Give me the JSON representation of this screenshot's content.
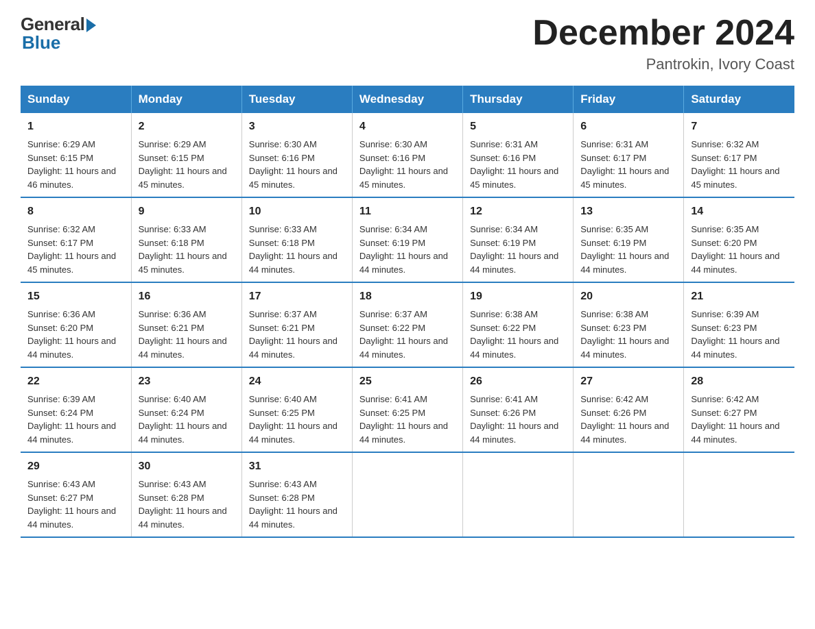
{
  "logo": {
    "general": "General",
    "blue": "Blue"
  },
  "title": "December 2024",
  "location": "Pantrokin, Ivory Coast",
  "weekdays": [
    "Sunday",
    "Monday",
    "Tuesday",
    "Wednesday",
    "Thursday",
    "Friday",
    "Saturday"
  ],
  "weeks": [
    [
      {
        "day": "1",
        "sunrise": "6:29 AM",
        "sunset": "6:15 PM",
        "daylight": "11 hours and 46 minutes."
      },
      {
        "day": "2",
        "sunrise": "6:29 AM",
        "sunset": "6:15 PM",
        "daylight": "11 hours and 45 minutes."
      },
      {
        "day": "3",
        "sunrise": "6:30 AM",
        "sunset": "6:16 PM",
        "daylight": "11 hours and 45 minutes."
      },
      {
        "day": "4",
        "sunrise": "6:30 AM",
        "sunset": "6:16 PM",
        "daylight": "11 hours and 45 minutes."
      },
      {
        "day": "5",
        "sunrise": "6:31 AM",
        "sunset": "6:16 PM",
        "daylight": "11 hours and 45 minutes."
      },
      {
        "day": "6",
        "sunrise": "6:31 AM",
        "sunset": "6:17 PM",
        "daylight": "11 hours and 45 minutes."
      },
      {
        "day": "7",
        "sunrise": "6:32 AM",
        "sunset": "6:17 PM",
        "daylight": "11 hours and 45 minutes."
      }
    ],
    [
      {
        "day": "8",
        "sunrise": "6:32 AM",
        "sunset": "6:17 PM",
        "daylight": "11 hours and 45 minutes."
      },
      {
        "day": "9",
        "sunrise": "6:33 AM",
        "sunset": "6:18 PM",
        "daylight": "11 hours and 45 minutes."
      },
      {
        "day": "10",
        "sunrise": "6:33 AM",
        "sunset": "6:18 PM",
        "daylight": "11 hours and 44 minutes."
      },
      {
        "day": "11",
        "sunrise": "6:34 AM",
        "sunset": "6:19 PM",
        "daylight": "11 hours and 44 minutes."
      },
      {
        "day": "12",
        "sunrise": "6:34 AM",
        "sunset": "6:19 PM",
        "daylight": "11 hours and 44 minutes."
      },
      {
        "day": "13",
        "sunrise": "6:35 AM",
        "sunset": "6:19 PM",
        "daylight": "11 hours and 44 minutes."
      },
      {
        "day": "14",
        "sunrise": "6:35 AM",
        "sunset": "6:20 PM",
        "daylight": "11 hours and 44 minutes."
      }
    ],
    [
      {
        "day": "15",
        "sunrise": "6:36 AM",
        "sunset": "6:20 PM",
        "daylight": "11 hours and 44 minutes."
      },
      {
        "day": "16",
        "sunrise": "6:36 AM",
        "sunset": "6:21 PM",
        "daylight": "11 hours and 44 minutes."
      },
      {
        "day": "17",
        "sunrise": "6:37 AM",
        "sunset": "6:21 PM",
        "daylight": "11 hours and 44 minutes."
      },
      {
        "day": "18",
        "sunrise": "6:37 AM",
        "sunset": "6:22 PM",
        "daylight": "11 hours and 44 minutes."
      },
      {
        "day": "19",
        "sunrise": "6:38 AM",
        "sunset": "6:22 PM",
        "daylight": "11 hours and 44 minutes."
      },
      {
        "day": "20",
        "sunrise": "6:38 AM",
        "sunset": "6:23 PM",
        "daylight": "11 hours and 44 minutes."
      },
      {
        "day": "21",
        "sunrise": "6:39 AM",
        "sunset": "6:23 PM",
        "daylight": "11 hours and 44 minutes."
      }
    ],
    [
      {
        "day": "22",
        "sunrise": "6:39 AM",
        "sunset": "6:24 PM",
        "daylight": "11 hours and 44 minutes."
      },
      {
        "day": "23",
        "sunrise": "6:40 AM",
        "sunset": "6:24 PM",
        "daylight": "11 hours and 44 minutes."
      },
      {
        "day": "24",
        "sunrise": "6:40 AM",
        "sunset": "6:25 PM",
        "daylight": "11 hours and 44 minutes."
      },
      {
        "day": "25",
        "sunrise": "6:41 AM",
        "sunset": "6:25 PM",
        "daylight": "11 hours and 44 minutes."
      },
      {
        "day": "26",
        "sunrise": "6:41 AM",
        "sunset": "6:26 PM",
        "daylight": "11 hours and 44 minutes."
      },
      {
        "day": "27",
        "sunrise": "6:42 AM",
        "sunset": "6:26 PM",
        "daylight": "11 hours and 44 minutes."
      },
      {
        "day": "28",
        "sunrise": "6:42 AM",
        "sunset": "6:27 PM",
        "daylight": "11 hours and 44 minutes."
      }
    ],
    [
      {
        "day": "29",
        "sunrise": "6:43 AM",
        "sunset": "6:27 PM",
        "daylight": "11 hours and 44 minutes."
      },
      {
        "day": "30",
        "sunrise": "6:43 AM",
        "sunset": "6:28 PM",
        "daylight": "11 hours and 44 minutes."
      },
      {
        "day": "31",
        "sunrise": "6:43 AM",
        "sunset": "6:28 PM",
        "daylight": "11 hours and 44 minutes."
      },
      null,
      null,
      null,
      null
    ]
  ]
}
